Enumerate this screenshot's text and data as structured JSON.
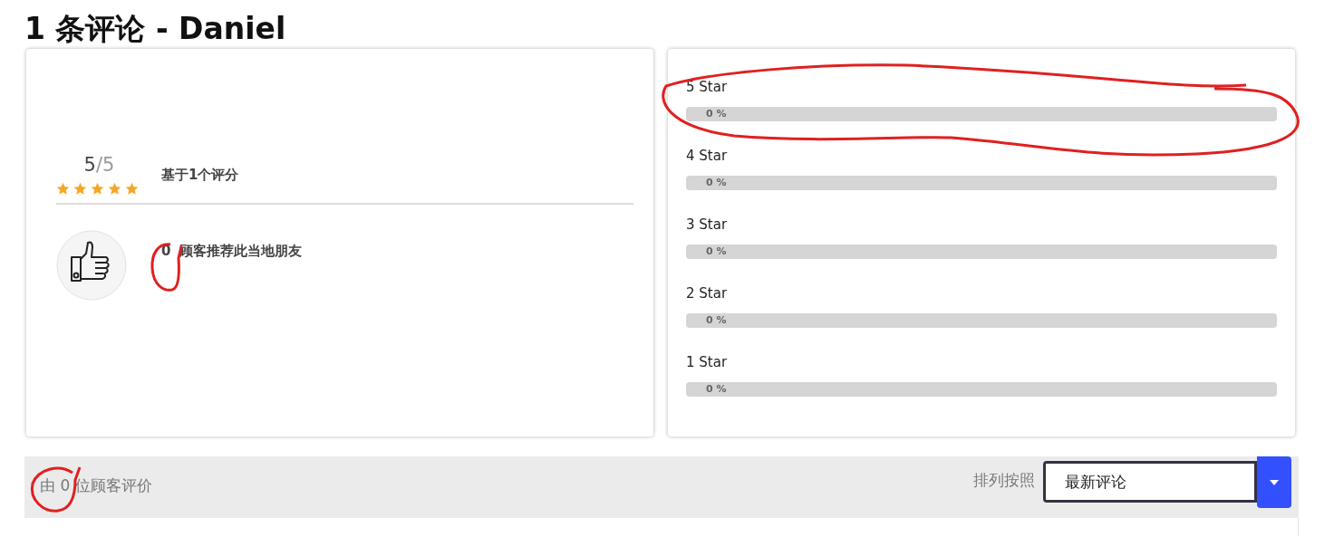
{
  "title": "1 条评论 - Daniel",
  "summary": {
    "score": "5",
    "out_of": "/5",
    "stars": 5,
    "based_on": "基于1个评分"
  },
  "recommend": {
    "count": "0",
    "text": "顾客推荐此当地朋友"
  },
  "breakdown": [
    {
      "label": "5 Star",
      "level": 0,
      "reading": "0 %"
    },
    {
      "label": "4 Star",
      "level": 0,
      "reading": "0 %"
    },
    {
      "label": "3 Star",
      "level": 0,
      "reading": "0 %"
    },
    {
      "label": "2 Star",
      "level": 0,
      "reading": "0 %"
    },
    {
      "label": "1 Star",
      "level": 0,
      "reading": "0 %"
    }
  ],
  "footer": {
    "review_count": "由 0 位顾客评价",
    "sort_label": "排列按照",
    "sort_value": "最新评论"
  }
}
